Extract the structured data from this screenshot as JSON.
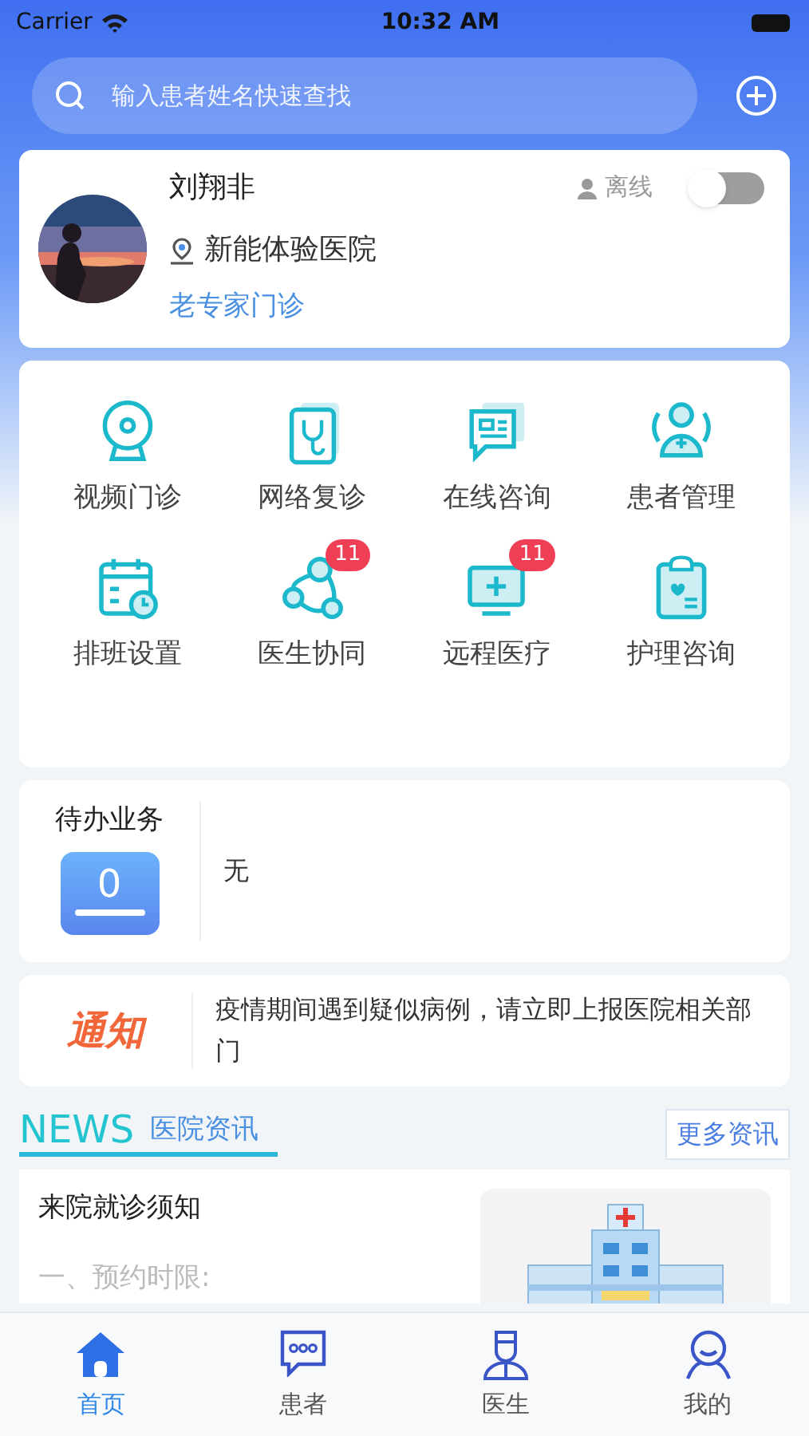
{
  "status_bar": {
    "carrier": "Carrier",
    "time": "10:32 AM"
  },
  "search": {
    "placeholder": "输入患者姓名快速查找"
  },
  "profile": {
    "name": "刘翔非",
    "hospital": "新能体验医院",
    "department": "老专家门诊",
    "status_label": "离线",
    "online": false
  },
  "menu": [
    {
      "label": "视频门诊"
    },
    {
      "label": "网络复诊"
    },
    {
      "label": "在线咨询"
    },
    {
      "label": "患者管理"
    },
    {
      "label": "排班设置"
    },
    {
      "label": "医生协同",
      "badge": "11"
    },
    {
      "label": "远程医疗",
      "badge": "11"
    },
    {
      "label": "护理咨询"
    }
  ],
  "todo": {
    "title": "待办业务",
    "count": "0",
    "content": "无"
  },
  "notice": {
    "label": "通知",
    "text": "疫情期间遇到疑似病例，请立即上报医院相关部门"
  },
  "news": {
    "title_en": "NEWS",
    "title": "医院资讯",
    "more": "更多资讯",
    "items": [
      {
        "title": "来院就诊须知",
        "excerpt": "一、预约时限:"
      }
    ]
  },
  "tab_bar": [
    {
      "label": "首页",
      "selected": true
    },
    {
      "label": "患者",
      "selected": false
    },
    {
      "label": "医生",
      "selected": false
    },
    {
      "label": "我的",
      "selected": false
    }
  ]
}
